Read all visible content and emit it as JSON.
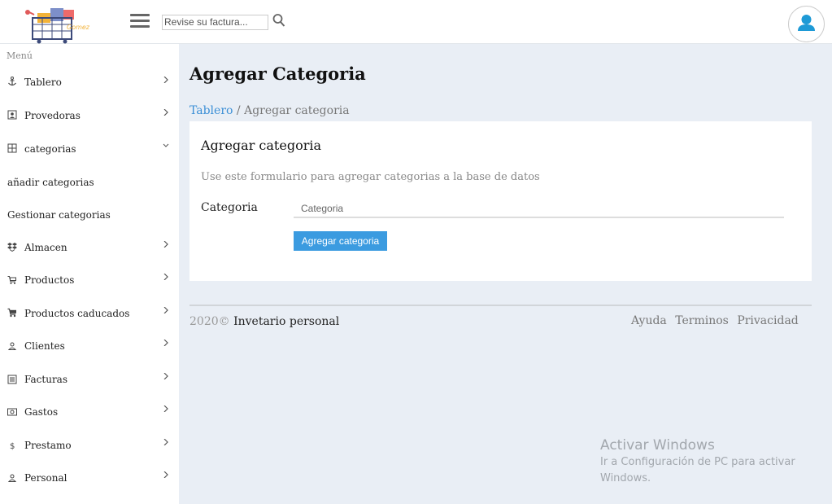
{
  "header": {
    "search_placeholder": "Revise su factura...",
    "logo_text": "Gomez"
  },
  "sidebar": {
    "heading": "Menú",
    "items": [
      {
        "label": "Tablero",
        "icon": "anchor-icon"
      },
      {
        "label": "Provedoras",
        "icon": "contact-card-icon"
      },
      {
        "label": "categorias",
        "icon": "grid-icon"
      },
      {
        "label": "añadir categorias"
      },
      {
        "label": "Gestionar categorias"
      },
      {
        "label": "Almacen",
        "icon": "dropbox-icon"
      },
      {
        "label": "Productos",
        "icon": "cart-icon"
      },
      {
        "label": "Productos caducados",
        "icon": "cart-filled-icon"
      },
      {
        "label": "Clientes",
        "icon": "user-icon"
      },
      {
        "label": "Facturas",
        "icon": "document-icon"
      },
      {
        "label": "Gastos",
        "icon": "money-icon"
      },
      {
        "label": "Prestamo",
        "icon": "dollar-icon"
      },
      {
        "label": "Personal",
        "icon": "person-icon"
      }
    ]
  },
  "main": {
    "title": "Agregar Categoria",
    "breadcrumb": {
      "link": "Tablero",
      "separator": " / ",
      "current": "Agregar categoria"
    },
    "card": {
      "title": "Agregar categoria",
      "description": "Use este formulario para agregar categorias a la base de datos",
      "field_label": "Categoria",
      "field_placeholder": "Categoria",
      "submit_label": "Agregar categoria"
    }
  },
  "footer": {
    "year": "2020©",
    "name": " Invetario personal",
    "links": [
      "Ayuda",
      "Terminos",
      "Privacidad"
    ]
  },
  "watermark": {
    "title": "Activar Windows",
    "subtitle": "Ir a Configuración de PC para activar Windows."
  },
  "colors": {
    "accent": "#3b9be0",
    "link": "#3b8fd6",
    "avatar": "#1e9ad6"
  }
}
